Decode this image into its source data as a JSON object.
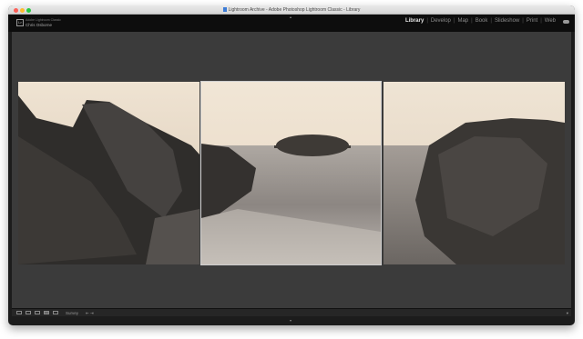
{
  "window": {
    "title": "Lightroom Archive - Adobe Photoshop Lightroom Classic - Library"
  },
  "identity_plate": {
    "logo": "Lr",
    "line1": "Adobe Lightroom Classic",
    "line2": "Chris Osborne"
  },
  "modules": [
    {
      "label": "Library",
      "active": true
    },
    {
      "label": "Develop",
      "active": false
    },
    {
      "label": "Map",
      "active": false
    },
    {
      "label": "Book",
      "active": false
    },
    {
      "label": "Slideshow",
      "active": false
    },
    {
      "label": "Print",
      "active": false
    },
    {
      "label": "Web",
      "active": false
    }
  ],
  "toolbar": {
    "view_mode_label": "Survey",
    "arrows": "⇤ ⇥",
    "end_glyph": "▾"
  },
  "survey_photos": [
    {
      "name": "rocky-shore-left"
    },
    {
      "name": "sea-island-center"
    },
    {
      "name": "rocky-shore-right"
    }
  ],
  "icons": {
    "cloud": "cloud-icon",
    "grid": "grid-view-icon",
    "loupe": "loupe-view-icon",
    "compare": "compare-view-icon",
    "survey": "survey-view-icon",
    "people": "people-view-icon"
  },
  "colors": {
    "window_bg": "#1c1c1c",
    "content_bg": "#3b3b3b",
    "active_module": "#e6e6e6",
    "inactive_module": "#8a8a8a"
  }
}
